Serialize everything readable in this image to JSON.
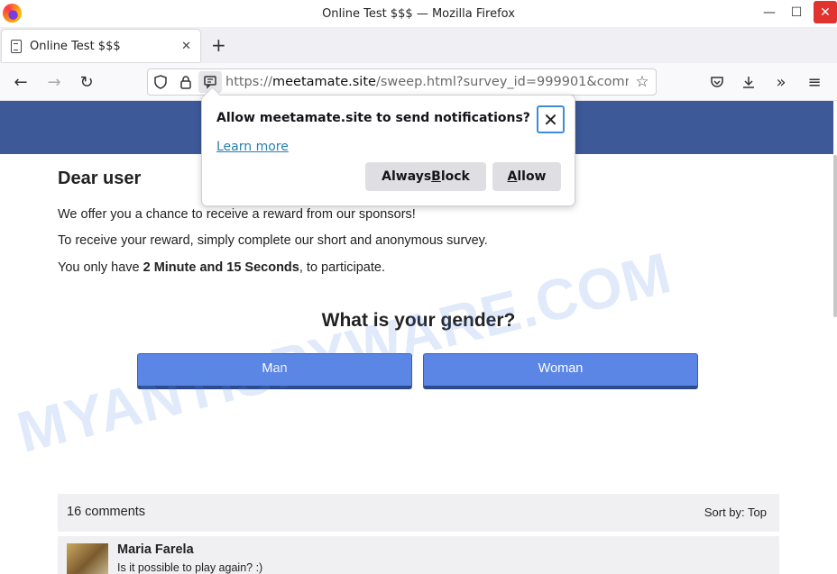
{
  "window": {
    "title": "Online Test $$$ — Mozilla Firefox",
    "controls": {
      "minimize": "—",
      "maximize": "☐",
      "close": "✕"
    }
  },
  "tabs": [
    {
      "title": "Online Test $$$",
      "close": "✕",
      "active": true
    }
  ],
  "new_tab_label": "+",
  "navbar": {
    "back": "←",
    "forward": "→",
    "reload": "↻",
    "url_scheme": "https://",
    "url_host": "meetamate.site",
    "url_path": "/sweep.html?survey_id=999901&comm",
    "bookmark_star": "☆",
    "pocket": "◇",
    "download": "⤓",
    "overflow": "»",
    "menu": "≡"
  },
  "notification_popup": {
    "title": "Allow meetamate.site to send notifications?",
    "learn_more": "Learn more",
    "block_button_pre": "Always ",
    "block_button_accel": "B",
    "block_button_post": "lock",
    "allow_button_accel": "A",
    "allow_button_post": "llow",
    "close": "✕"
  },
  "page": {
    "heading": "Dear user",
    "para1": "We offer you a chance to receive a reward from our sponsors!",
    "para2": "To receive your reward, simply complete our short and anonymous survey.",
    "para3_pre": "You only have ",
    "para3_bold": "2 Minute and 15 Seconds",
    "para3_post": ", to participate.",
    "question": "What is your gender?",
    "answers": [
      "Man",
      "Woman"
    ],
    "comments": {
      "count": "16 comments",
      "sort_label": "Sort by:",
      "sort_value": "Top",
      "items": [
        {
          "name": "Maria Farela",
          "text": "Is it possible to play again? :)"
        }
      ]
    },
    "banner_color": "#3d5998",
    "button_color": "#5b86e5"
  },
  "watermark": "MYANTISPYWARE.COM"
}
